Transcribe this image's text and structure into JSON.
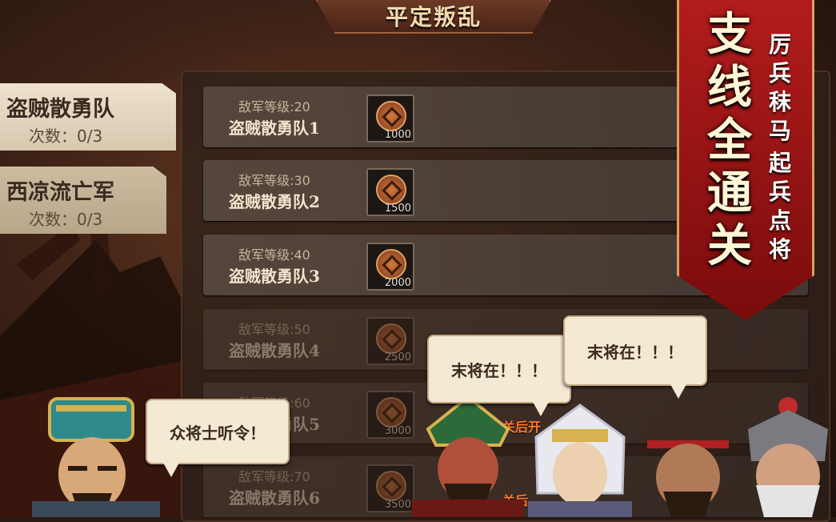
{
  "title": "平定叛乱",
  "tabs": [
    {
      "title": "盗贼散勇队",
      "count": "次数：0/3"
    },
    {
      "title": "西凉流亡军",
      "count": "次数：0/3"
    }
  ],
  "stages": [
    {
      "level": "敌军等级:20",
      "name": "盗贼散勇队1",
      "reward": "1000"
    },
    {
      "level": "敌军等级:30",
      "name": "盗贼散勇队2",
      "reward": "1500"
    },
    {
      "level": "敌军等级:40",
      "name": "盗贼散勇队3",
      "reward": "2000"
    },
    {
      "level": "敌军等级:50",
      "name": "盗贼散勇队4",
      "reward": "2500"
    },
    {
      "level": "敌军等级:60",
      "name": "盗贼散勇队5",
      "reward": "3000"
    },
    {
      "level": "敌军等级:70",
      "name": "盗贼散勇队6",
      "reward": "3500"
    }
  ],
  "unlock_hint_1": "关后开",
  "unlock_hint_2": "关后",
  "promo": {
    "main": "支线全通关",
    "sub1": "厉兵秣马",
    "sub2": "起兵点将"
  },
  "bubbles": {
    "left": "众将士听令！",
    "middle": "末将在！！！",
    "right": "末将在！！！"
  },
  "colors": {
    "promo_red": "#b21c1c",
    "tab_bg": "#efe3cf",
    "coin": "#d27a3a"
  }
}
